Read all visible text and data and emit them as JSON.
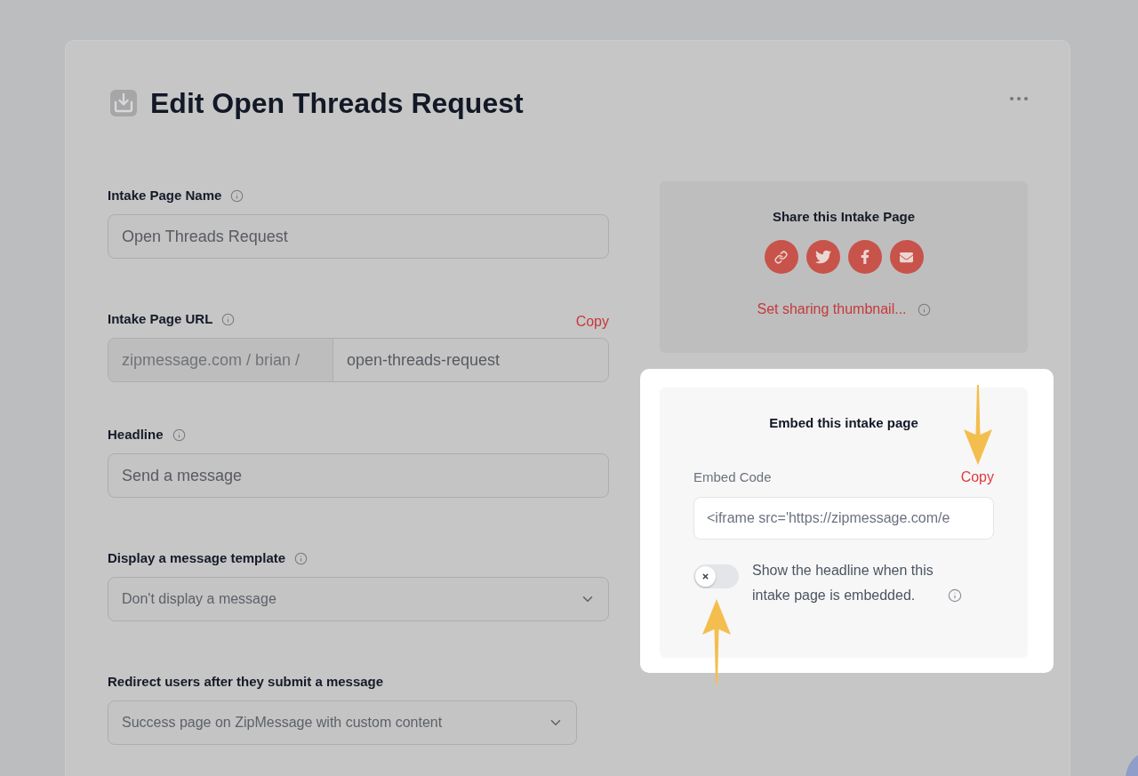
{
  "page": {
    "title": "Edit Open Threads Request"
  },
  "fields": [
    {
      "kind": "text",
      "label": "Intake Page Name",
      "info": true,
      "value": "Open Threads Request"
    },
    {
      "kind": "url",
      "label": "Intake Page URL",
      "info": true,
      "action": "Copy",
      "prefix": "zipmessage.com / brian /",
      "value": "open-threads-request"
    },
    {
      "kind": "text",
      "label": "Headline",
      "info": true,
      "value": "Send a message"
    },
    {
      "kind": "select",
      "label": "Display a message template",
      "info": true,
      "value": "Don't display a message"
    },
    {
      "kind": "select",
      "label": "Redirect users after they submit a message",
      "value": "Success page on ZipMessage with custom content"
    }
  ],
  "share_panel": {
    "title": "Share this Intake Page",
    "link": "Set sharing thumbnail...",
    "info": true
  },
  "embed_panel": {
    "highlighted": true,
    "title": "Embed this intake page",
    "label": "Embed Code",
    "action": "Copy",
    "code": "<iframe src='https://zipmessage.com/e",
    "toggle": {
      "on": false,
      "label": "Show the headline when this intake page is embedded.",
      "info": true
    }
  }
}
